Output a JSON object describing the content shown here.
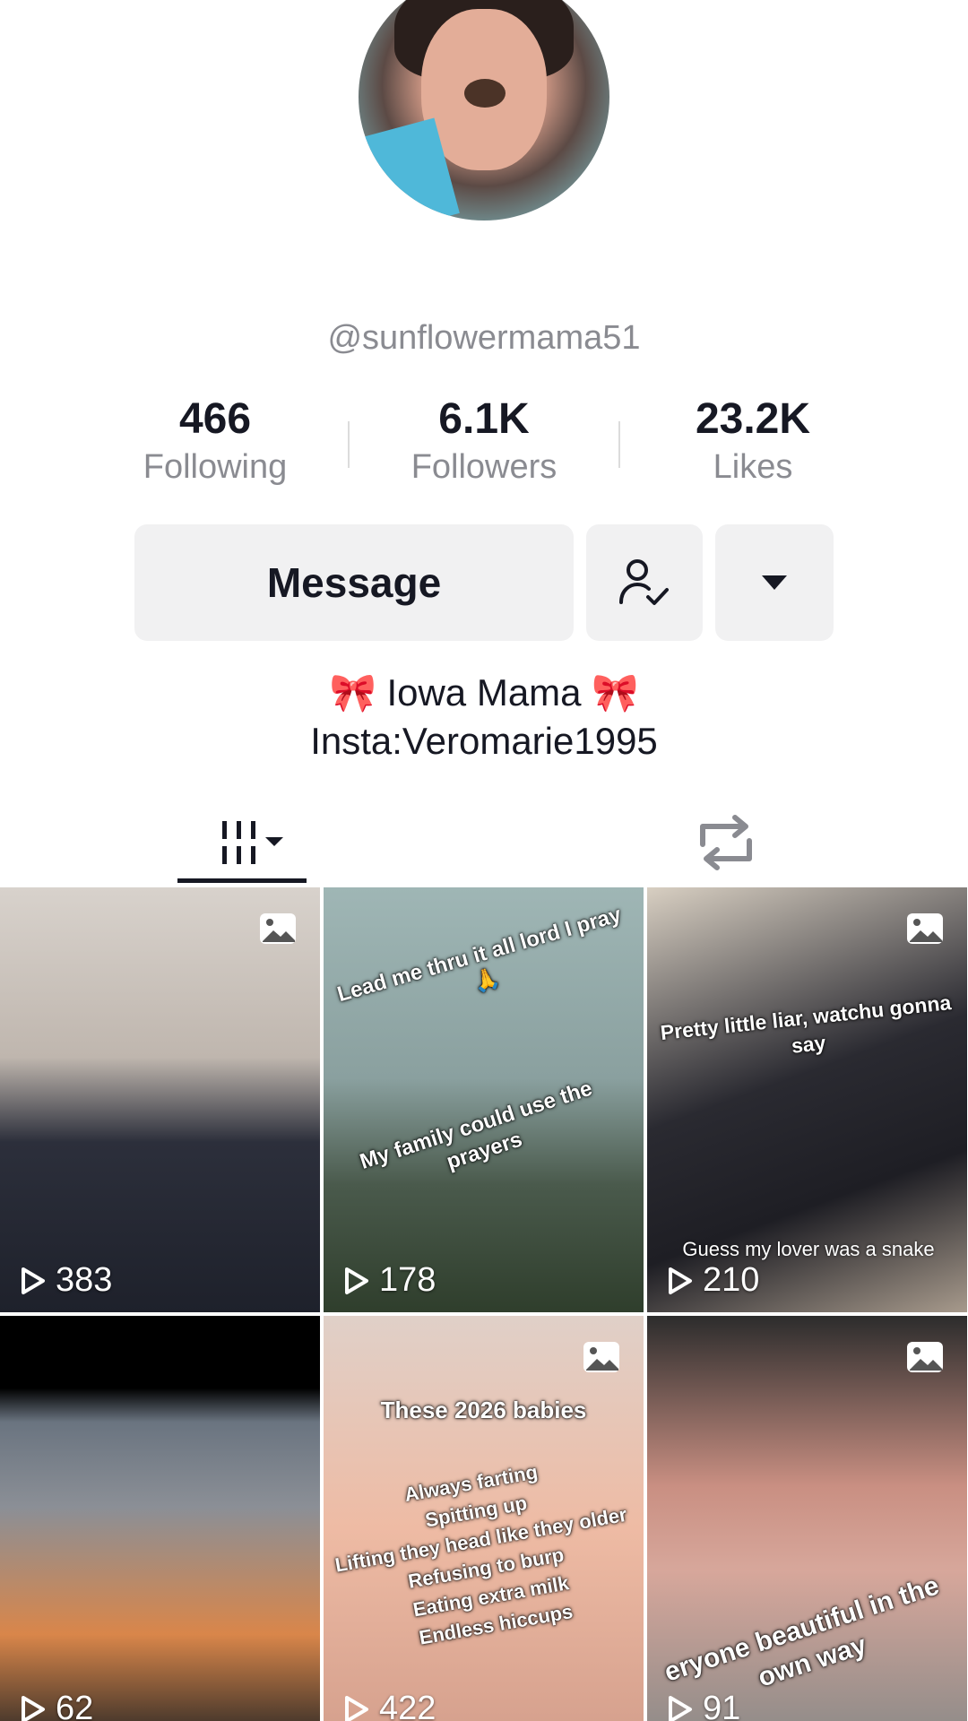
{
  "profile": {
    "username": "@sunflowermama51",
    "bio_line1": "🎀 Iowa Mama 🎀",
    "bio_line2": "Insta:Veromarie1995"
  },
  "stats": [
    {
      "value": "466",
      "label": "Following"
    },
    {
      "value": "6.1K",
      "label": "Followers"
    },
    {
      "value": "23.2K",
      "label": "Likes"
    }
  ],
  "actions": {
    "message_label": "Message",
    "follow_icon": "user-check-icon",
    "more_icon": "caret-down-icon"
  },
  "tabs": [
    {
      "icon": "grid-icon",
      "selected": true
    },
    {
      "icon": "repost-icon",
      "selected": false
    }
  ],
  "videos": [
    {
      "views": "383",
      "photo": true,
      "captions": []
    },
    {
      "views": "178",
      "photo": false,
      "captions": [
        "Lead me thru it all lord I pray 🙏",
        "My family could use the prayers"
      ]
    },
    {
      "views": "210",
      "photo": true,
      "captions": [
        "Pretty little liar, watchu gonna say",
        "Guess my lover was a snake"
      ]
    },
    {
      "views": "62",
      "photo": false,
      "captions": []
    },
    {
      "views": "422",
      "photo": true,
      "captions": [
        "These 2026 babies",
        "Always farting\nSpitting up\nLifting they head like they older\nRefusing to burp\nEating extra milk\nEndless hiccups"
      ]
    },
    {
      "views": "91",
      "photo": true,
      "captions": [
        "eryone beautiful in the own way"
      ]
    }
  ],
  "colors": {
    "text_primary": "#161823",
    "text_secondary": "#8a8b91",
    "button_bg": "#f1f1f2"
  }
}
